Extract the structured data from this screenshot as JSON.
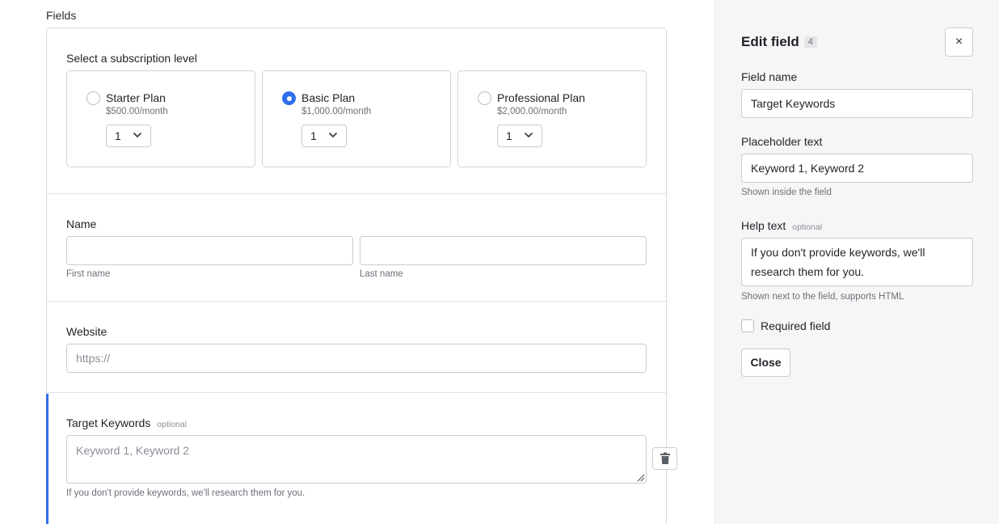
{
  "fields": {
    "section_title": "Fields",
    "subscription": {
      "label": "Select a subscription level",
      "plans": [
        {
          "name": "Starter Plan",
          "price": "$500.00/month",
          "qty": "1",
          "selected": false
        },
        {
          "name": "Basic Plan",
          "price": "$1,000.00/month",
          "qty": "1",
          "selected": true
        },
        {
          "name": "Professional Plan",
          "price": "$2,000.00/month",
          "qty": "1",
          "selected": false
        }
      ]
    },
    "name": {
      "label": "Name",
      "first_value": "",
      "last_value": "",
      "first_sub": "First name",
      "last_sub": "Last name"
    },
    "website": {
      "label": "Website",
      "placeholder": "https://"
    },
    "keywords": {
      "label": "Target Keywords",
      "optional": "optional",
      "placeholder": "Keyword 1, Keyword 2",
      "help": "If you don't provide keywords, we'll research them for you."
    }
  },
  "panel": {
    "title": "Edit field",
    "count": "4",
    "close_icon": "×",
    "field_name_label": "Field name",
    "field_name_value": "Target Keywords",
    "placeholder_label": "Placeholder text",
    "placeholder_value": "Keyword 1, Keyword 2",
    "placeholder_sub": "Shown inside the field",
    "help_label": "Help text",
    "help_optional": "optional",
    "help_value": "If you don't provide keywords, we'll research them for you.",
    "help_sub": "Shown next to the field, supports HTML",
    "required_label": "Required field",
    "required_checked": false,
    "close_label": "Close"
  },
  "colors": {
    "accent": "#2f6fed",
    "border": "#c9ccd1",
    "panel_bg": "#f6f6f7"
  }
}
